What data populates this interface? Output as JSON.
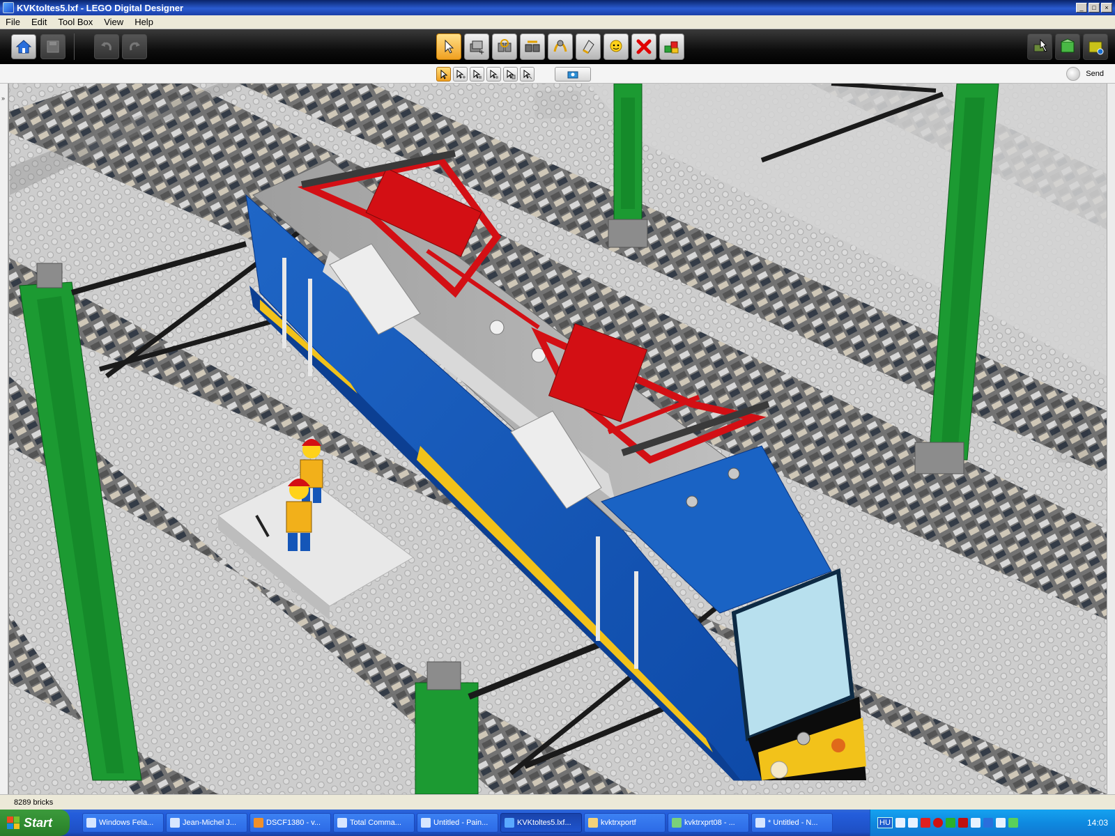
{
  "window": {
    "title": "KVKtoltes5.lxf - LEGO Digital Designer",
    "buttons": [
      "minimize",
      "restore",
      "close"
    ]
  },
  "menu": {
    "items": [
      "File",
      "Edit",
      "Tool Box",
      "View",
      "Help"
    ]
  },
  "toolbar": {
    "left_icons": [
      "home-icon",
      "save-icon",
      "undo-icon",
      "redo-icon"
    ],
    "tools": [
      "select-tool",
      "clone-tool",
      "hinge-tool",
      "hinge-align-tool",
      "flex-tool",
      "paint-tool",
      "hide-tool",
      "delete-tool",
      "group-tool"
    ],
    "active_tool": "select-tool",
    "mode_icons": [
      "build-mode-icon",
      "view-mode-icon",
      "building-guide-mode-icon"
    ]
  },
  "subtoolbar": {
    "tools": [
      "single-select",
      "multi-select",
      "connected-select",
      "same-color-select",
      "same-shape-select",
      "invert-select",
      "camera-control"
    ],
    "send_label": "Send"
  },
  "status": {
    "brick_count": "8289 bricks"
  },
  "taskbar": {
    "start_label": "Start",
    "tasks": [
      "Windows Fela...",
      "Jean-Michel J...",
      "DSCF1380 - v...",
      "Total Comma...",
      "Untitled - Pain...",
      "KVKtoltes5.lxf...",
      "kvktrxportf",
      "kvktrxprt08 - ...",
      "* Untitled - N..."
    ],
    "active_task": 5,
    "language": "HU",
    "clock": "14:03"
  },
  "colors": {
    "train_blue": "#1556b8",
    "stripe_yellow": "#f2c21a",
    "pantograph_red": "#d30f14",
    "mast_green": "#1c9a32",
    "baseplate_grey": "#c9c9c9",
    "track_dark": "#5a5a5a"
  }
}
